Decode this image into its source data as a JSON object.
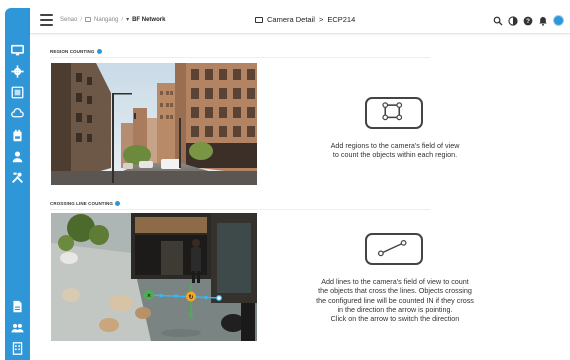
{
  "breadcrumb": {
    "items": [
      "Senao",
      "Nangang",
      "BF Network"
    ]
  },
  "header": {
    "title_section": "Camera Detail",
    "title_sep": ">",
    "title_device": "ECP214"
  },
  "top_icons": [
    "search-icon",
    "contrast-icon",
    "help-icon",
    "bell-icon",
    "avatar"
  ],
  "sidebar": {
    "items": [
      "monitor-icon",
      "gear-icon",
      "dashboard-icon",
      "cloud-icon",
      "device-icon",
      "user-icon",
      "tools-icon",
      "report-icon",
      "team-icon",
      "building-icon"
    ]
  },
  "region_counting": {
    "label": "REGION COUNTING",
    "description_line1": "Add regions to the camera's field of view",
    "description_line2": "to count the objects within each region."
  },
  "crossing_line_counting": {
    "label": "CROSSING LINE COUNTING",
    "description_lines": [
      "Add lines to the camera's field of view to count",
      "the objects that cross the lines. Objects crossing",
      "the configured line will be counted IN if they cross",
      "in the direction the arrow is pointing.",
      "Click on the arrow to switch the direction"
    ]
  },
  "colors": {
    "sidebar": "#2f97d8",
    "accent": "#2f97d8",
    "line": "#38b6f0",
    "line_start": "#4caf50",
    "line_end": "#f5a623"
  }
}
